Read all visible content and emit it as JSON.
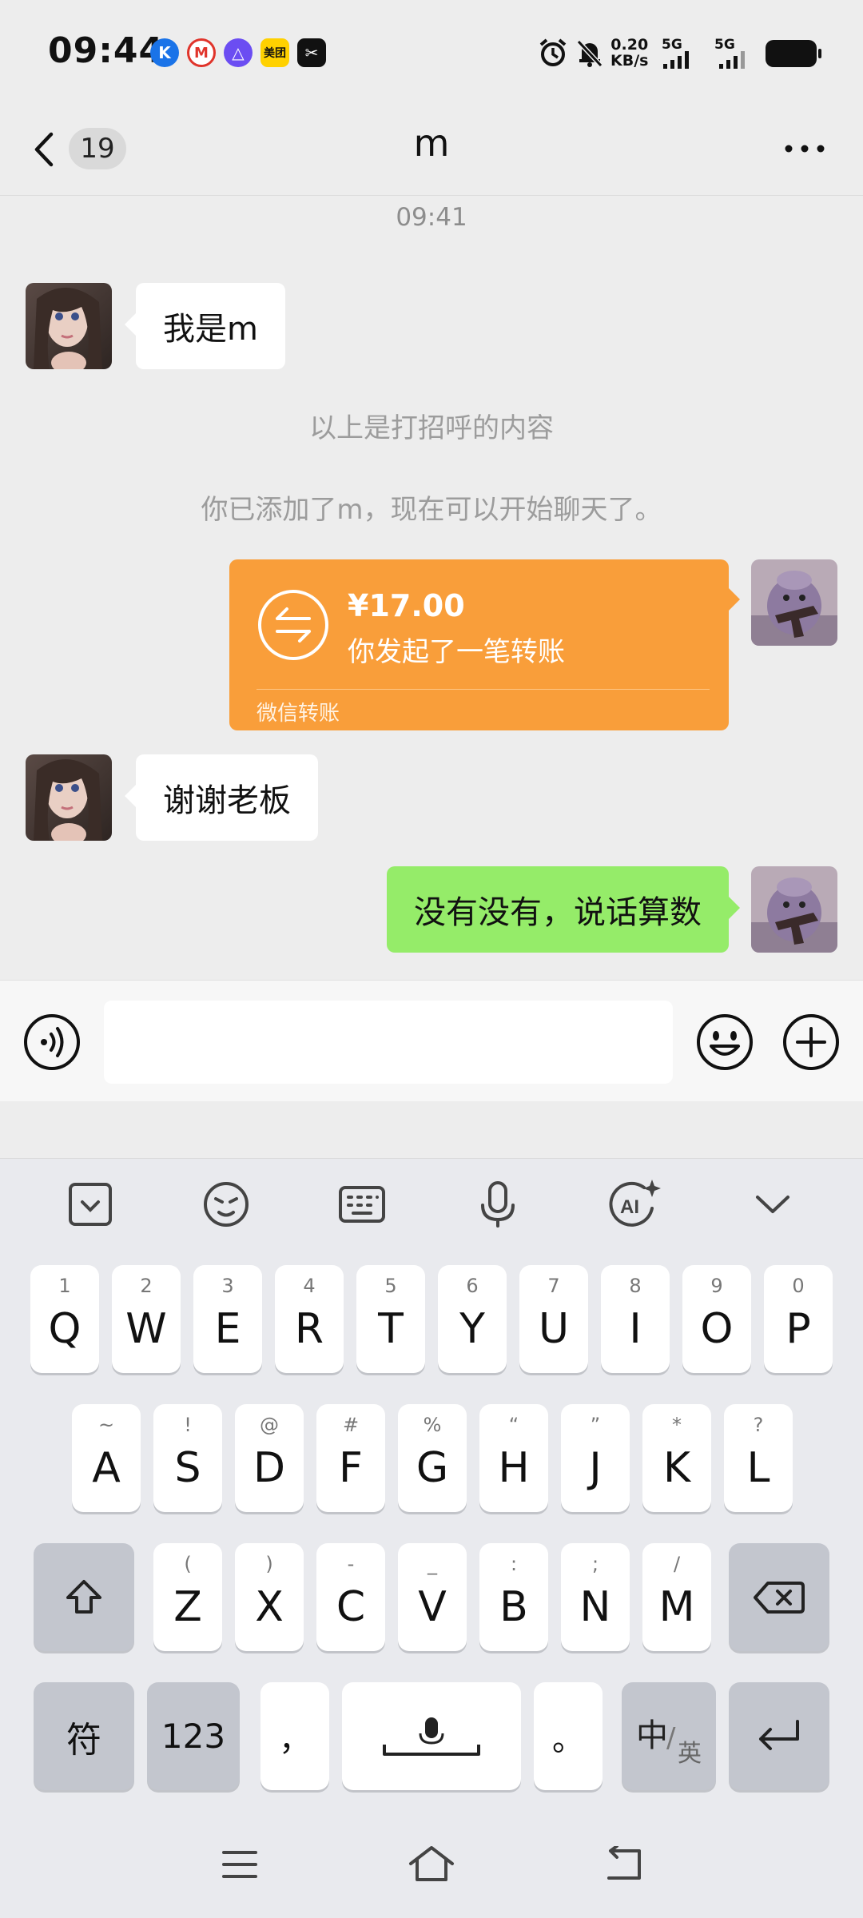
{
  "status_bar": {
    "time": "09:44",
    "net_speed": "0.20",
    "net_unit": "KB/s",
    "sim1": "5G",
    "sim2": "5G",
    "meituan_label": "美团",
    "icons": [
      "app-k-icon",
      "app-m-icon",
      "app-triangle-icon",
      "meituan-icon",
      "capcut-icon",
      "alarm-icon",
      "mute-icon",
      "signal-icon",
      "battery-icon"
    ]
  },
  "header": {
    "back_count": "19",
    "title": "m",
    "more": "···"
  },
  "chat": {
    "timestamp": "09:41",
    "messages": [
      {
        "side": "left",
        "type": "text",
        "text": "我是m"
      },
      {
        "type": "system",
        "text": "以上是打招呼的内容"
      },
      {
        "type": "system",
        "text": "你已添加了m，现在可以开始聊天了。"
      },
      {
        "side": "right",
        "type": "transfer",
        "amount": "¥17.00",
        "description": "你发起了一笔转账",
        "footer": "微信转账"
      },
      {
        "side": "left",
        "type": "text",
        "text": "谢谢老板"
      },
      {
        "side": "right",
        "type": "text",
        "text": "没有没有，说话算数"
      }
    ]
  },
  "input": {
    "placeholder": ""
  },
  "keyboard": {
    "row1": [
      {
        "hint": "1",
        "label": "Q"
      },
      {
        "hint": "2",
        "label": "W"
      },
      {
        "hint": "3",
        "label": "E"
      },
      {
        "hint": "4",
        "label": "R"
      },
      {
        "hint": "5",
        "label": "T"
      },
      {
        "hint": "6",
        "label": "Y"
      },
      {
        "hint": "7",
        "label": "U"
      },
      {
        "hint": "8",
        "label": "I"
      },
      {
        "hint": "9",
        "label": "O"
      },
      {
        "hint": "0",
        "label": "P"
      }
    ],
    "row2": [
      {
        "hint": "~",
        "label": "A"
      },
      {
        "hint": "!",
        "label": "S"
      },
      {
        "hint": "@",
        "label": "D"
      },
      {
        "hint": "#",
        "label": "F"
      },
      {
        "hint": "%",
        "label": "G"
      },
      {
        "hint": "“",
        "label": "H"
      },
      {
        "hint": "”",
        "label": "J"
      },
      {
        "hint": "*",
        "label": "K"
      },
      {
        "hint": "?",
        "label": "L"
      }
    ],
    "row3": [
      {
        "hint": "(",
        "label": "Z"
      },
      {
        "hint": ")",
        "label": "X"
      },
      {
        "hint": "-",
        "label": "C"
      },
      {
        "hint": "_",
        "label": "V"
      },
      {
        "hint": ":",
        "label": "B"
      },
      {
        "hint": ";",
        "label": "N"
      },
      {
        "hint": "/",
        "label": "M"
      }
    ],
    "symbols_label": "符",
    "numbers_label": "123",
    "comma_label": "，",
    "period_label": "。",
    "lang_primary": "中",
    "lang_secondary": "英"
  }
}
